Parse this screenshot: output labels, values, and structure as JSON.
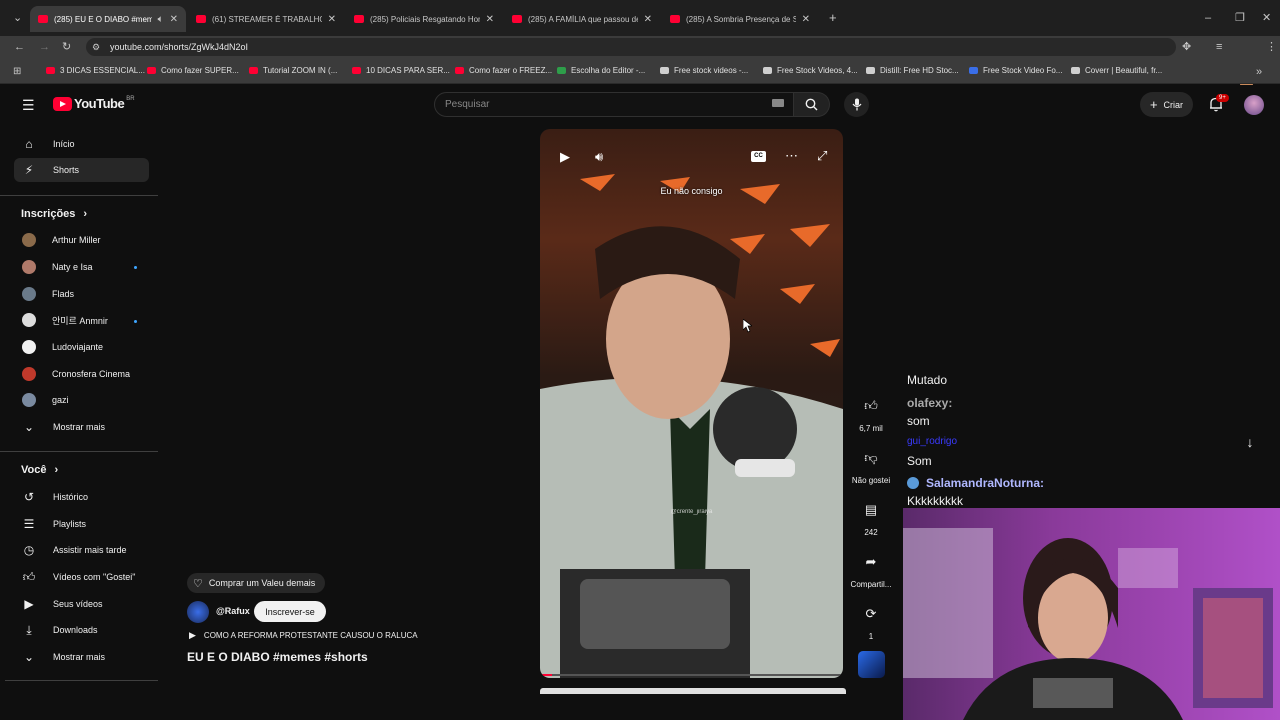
{
  "browser": {
    "tabs": [
      {
        "title": "(285) EU E O DIABO #meme",
        "active": true
      },
      {
        "title": "(61) STREAMER É TRABALHO?",
        "active": false
      },
      {
        "title": "(285) Policiais Resgatando Hom",
        "active": false
      },
      {
        "title": "(285) A FAMÍLIA que passou de",
        "active": false
      },
      {
        "title": "(285) A Sombria Presença de Sa",
        "active": false
      }
    ],
    "url": "youtube.com/shorts/ZgWkJ4dN2oI",
    "bookmarks": [
      "3 DICAS ESSENCIAL...",
      "Como fazer SUPER...",
      "Tutorial ZOOM IN (...",
      "10 DICAS PARA SER...",
      "Como fazer o FREEZ...",
      "Escolha do Editor -...",
      "Free stock videos -...",
      "Free Stock Videos, 4...",
      "Distill: Free HD Stoc...",
      "Free Stock Video Fo...",
      "Coverr | Beautiful, fr..."
    ]
  },
  "youtube": {
    "logo_text": "YouTube",
    "region": "BR",
    "search_placeholder": "Pesquisar",
    "create_label": "Criar",
    "notif_badge": "9+",
    "sidebar": {
      "main": [
        {
          "label": "Início",
          "icon": "home-icon"
        },
        {
          "label": "Shorts",
          "icon": "shorts-icon"
        }
      ],
      "subs_title": "Inscrições",
      "subs": [
        {
          "label": "Arthur Miller",
          "dot": false,
          "color": "#8a6a4a"
        },
        {
          "label": "Naty e Isa",
          "dot": true,
          "color": "#b07a6a"
        },
        {
          "label": "Flads",
          "dot": false,
          "color": "#6a7a8a"
        },
        {
          "label": "안미르 Anmnir",
          "dot": true,
          "color": "#dddddd"
        },
        {
          "label": "Ludoviajante",
          "dot": false,
          "color": "#f1f1f1"
        },
        {
          "label": "Cronosfera Cinema",
          "dot": false,
          "color": "#c0392b"
        },
        {
          "label": "gazi",
          "dot": false,
          "color": "#7a8aa0"
        }
      ],
      "show_more_1": "Mostrar mais",
      "you_title": "Você",
      "you": [
        {
          "label": "Histórico",
          "icon": "history-icon"
        },
        {
          "label": "Playlists",
          "icon": "playlists-icon"
        },
        {
          "label": "Assistir mais tarde",
          "icon": "watch-later-icon"
        },
        {
          "label": "Vídeos com \"Gostei\"",
          "icon": "like-icon"
        },
        {
          "label": "Seus vídeos",
          "icon": "your-videos-icon"
        },
        {
          "label": "Downloads",
          "icon": "downloads-icon"
        }
      ],
      "show_more_2": "Mostrar mais"
    },
    "video": {
      "caption": "Eu não consigo",
      "watermark": "@crente_jiraiya"
    },
    "meta": {
      "buy_label": "Comprar um Valeu demais",
      "channel": "@Rafux",
      "subscribe": "Inscrever-se",
      "playlist": "COMO A REFORMA PROTESTANTE CAUSOU O RALUCA",
      "title": "EU E O DIABO #memes #shorts"
    },
    "actions": {
      "likes": "6,7 mil",
      "dislike": "Não gostei",
      "comments": "242",
      "share": "Compartil...",
      "remix": "1"
    }
  },
  "overlay_chat": {
    "lines": [
      {
        "text": "Mutado",
        "color": "#f1f1f1",
        "bold": false
      },
      {
        "text": "olafexy:",
        "color": "#aaaaaa",
        "bold": true
      },
      {
        "text": "som",
        "color": "#f1f1f1",
        "bold": false
      },
      {
        "text": "gui_rodrigo",
        "color": "#3a3aff",
        "bold": false
      },
      {
        "text": "Som",
        "color": "#f1f1f1",
        "bold": false
      },
      {
        "text": "SalamandraNoturna:",
        "color": "#b0b8ff",
        "bold": true
      },
      {
        "text": "Kkkkkkkkk",
        "color": "#f1f1f1",
        "bold": false
      }
    ]
  }
}
